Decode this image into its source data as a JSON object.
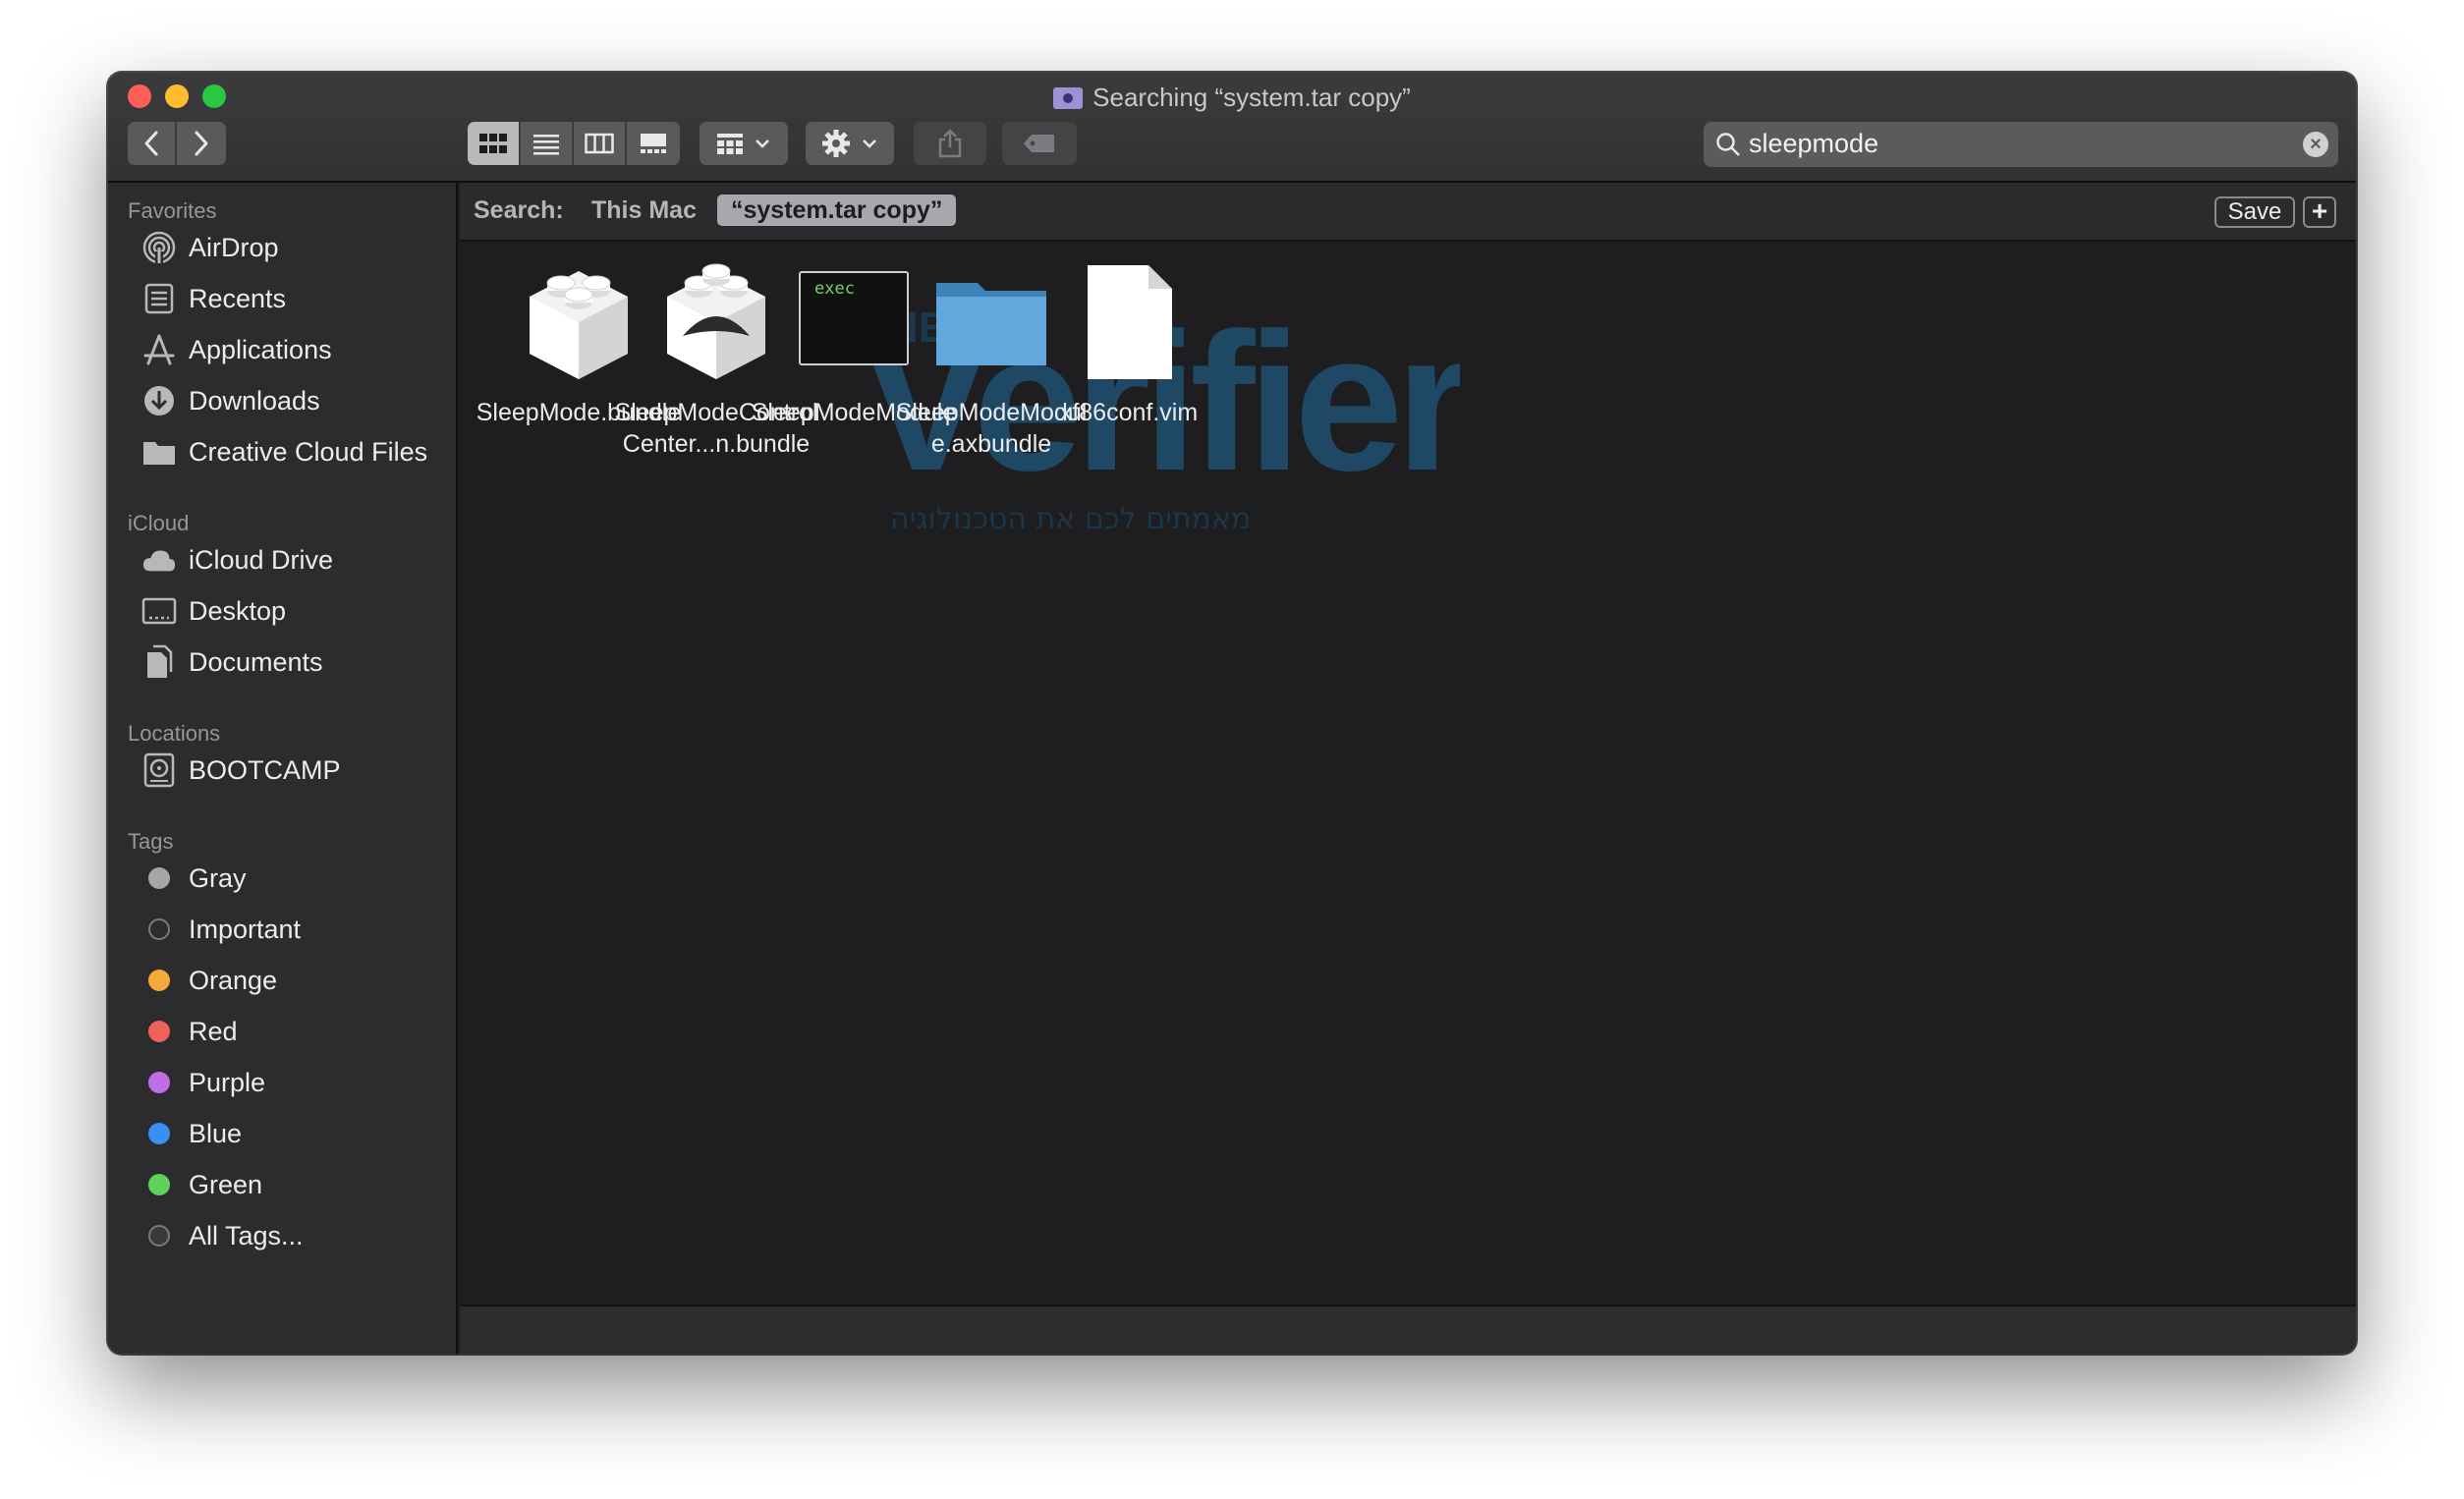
{
  "window": {
    "title": "Searching “system.tar copy”"
  },
  "toolbar": {
    "nav": {
      "back_icon": "chevron-left-icon",
      "forward_icon": "chevron-right-icon"
    },
    "view_modes": [
      "icon-view",
      "list-view",
      "column-view",
      "gallery-view"
    ],
    "active_view": "icon-view",
    "group_icon": "group-grid-icon",
    "action_icon": "gear-icon",
    "share_icon": "share-icon",
    "tag_icon": "tag-icon",
    "search": {
      "value": "sleepmode",
      "icon": "magnifier-icon"
    }
  },
  "sidebar": {
    "favorites_header": "Favorites",
    "favorites": [
      {
        "label": "AirDrop",
        "icon": "airdrop-icon"
      },
      {
        "label": "Recents",
        "icon": "recents-icon"
      },
      {
        "label": "Applications",
        "icon": "applications-icon"
      },
      {
        "label": "Downloads",
        "icon": "downloads-icon"
      },
      {
        "label": "Creative Cloud Files",
        "icon": "folder-icon"
      }
    ],
    "icloud_header": "iCloud",
    "icloud": [
      {
        "label": "iCloud Drive",
        "icon": "cloud-icon"
      },
      {
        "label": "Desktop",
        "icon": "desktop-icon"
      },
      {
        "label": "Documents",
        "icon": "documents-icon"
      }
    ],
    "locations_header": "Locations",
    "locations": [
      {
        "label": "BOOTCAMP",
        "icon": "disk-icon"
      }
    ],
    "tags_header": "Tags",
    "tags": [
      {
        "label": "Gray",
        "color": "#a6a6a8"
      },
      {
        "label": "Important",
        "color": "none"
      },
      {
        "label": "Orange",
        "color": "#f5a93a"
      },
      {
        "label": "Red",
        "color": "#f0615a"
      },
      {
        "label": "Purple",
        "color": "#bf6ee8"
      },
      {
        "label": "Blue",
        "color": "#3a8ff5"
      },
      {
        "label": "Green",
        "color": "#5fd25a"
      },
      {
        "label": "All Tags...",
        "color": "multi"
      }
    ]
  },
  "scope": {
    "search_label": "Search:",
    "this_mac": "This Mac",
    "folder": "“system.tar copy”",
    "save": "Save",
    "add": "+"
  },
  "files": [
    {
      "name": "SleepMode.bundl​e",
      "icon": "lego-bundle-icon"
    },
    {
      "name": "SleepModeContro​lCenter...n.bundle",
      "icon": "lego-bundle-icon"
    },
    {
      "name": "SleepModeModul​e",
      "icon": "exec-icon",
      "badge": "exec"
    },
    {
      "name": "SleepModeModul​e.axbundle",
      "icon": "folder-icon"
    },
    {
      "name": "xf86conf.vim",
      "icon": "document-icon"
    }
  ],
  "watermark": {
    "text": "THE Verifier",
    "subtext": "מאמתים לכם את הטכנולוגיה"
  }
}
